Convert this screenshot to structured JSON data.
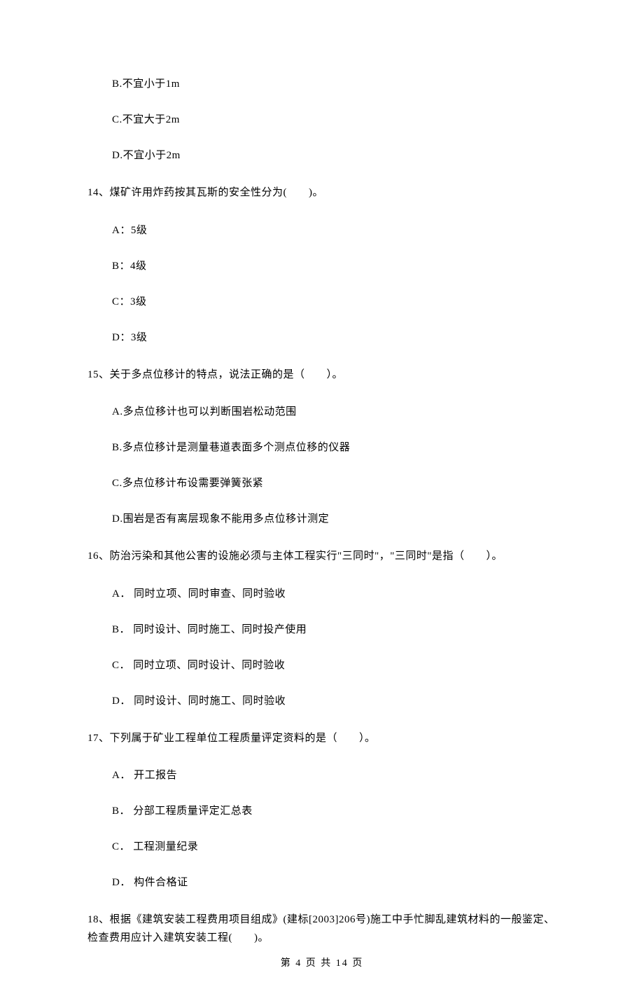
{
  "options_top": {
    "b": "B.不宜小于1m",
    "c": "C.不宜大于2m",
    "d": "D.不宜小于2m"
  },
  "q14": {
    "stem": "14、煤矿许用炸药按其瓦斯的安全性分为(　　)。",
    "a": "A：5级",
    "b": "B：4级",
    "c": "C：3级",
    "d": "D：3级"
  },
  "q15": {
    "stem": "15、关于多点位移计的特点，说法正确的是（　　）。",
    "a": "A.多点位移计也可以判断围岩松动范围",
    "b": "B.多点位移计是测量巷道表面多个测点位移的仪器",
    "c": "C.多点位移计布设需要弹簧张紧",
    "d": "D.围岩是否有离层现象不能用多点位移计测定"
  },
  "q16": {
    "stem": "16、防治污染和其他公害的设施必须与主体工程实行\"三同时\"，\"三同时\"是指（　　）。",
    "a": "A． 同时立项、同时审查、同时验收",
    "b": "B． 同时设计、同时施工、同时投产使用",
    "c": "C． 同时立项、同时设计、同时验收",
    "d": "D． 同时设计、同时施工、同时验收"
  },
  "q17": {
    "stem": "17、下列属于矿业工程单位工程质量评定资料的是（　　）。",
    "a": "A． 开工报告",
    "b": "B． 分部工程质量评定汇总表",
    "c": "C． 工程测量纪录",
    "d": "D． 构件合格证"
  },
  "q18": {
    "stem": "18、根据《建筑安装工程费用项目组成》(建标[2003]206号)施工中手忙脚乱建筑材料的一般鉴定、检查费用应计入建筑安装工程(　　)。"
  },
  "footer": "第 4 页 共 14 页"
}
